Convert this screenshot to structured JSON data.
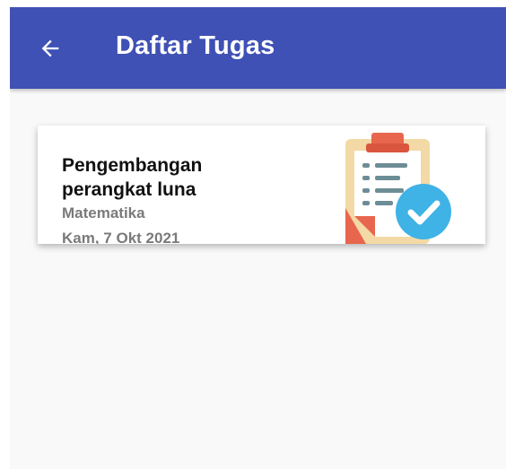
{
  "app_bar": {
    "title": "Daftar Tugas",
    "background": "#3f51b5",
    "back_icon": "arrow-left-icon"
  },
  "tasks": [
    {
      "title": "Pengembangan perangkat luna",
      "subject": "Matematika",
      "date": "Kam, 7 Okt 2021",
      "icon": "clipboard-check-icon"
    }
  ],
  "colors": {
    "screen_background": "#f9f9f9",
    "card_background": "#ffffff",
    "secondary_text": "#7a7a7a",
    "clipboard_board": "#f3d9a5",
    "clipboard_clip": "#e8664e",
    "check_badge": "#3fb2e6"
  }
}
